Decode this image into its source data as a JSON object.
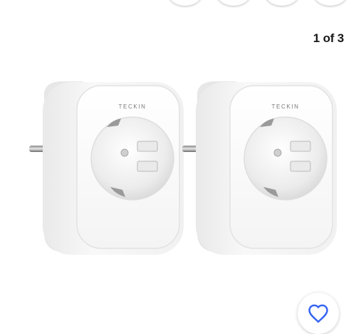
{
  "gallery": {
    "counter": "1 of 3",
    "brand_label": "TECKIN"
  },
  "icons": {
    "favorite": "heart-outline-icon"
  },
  "colors": {
    "accent": "#3665f3",
    "text": "#191919"
  }
}
